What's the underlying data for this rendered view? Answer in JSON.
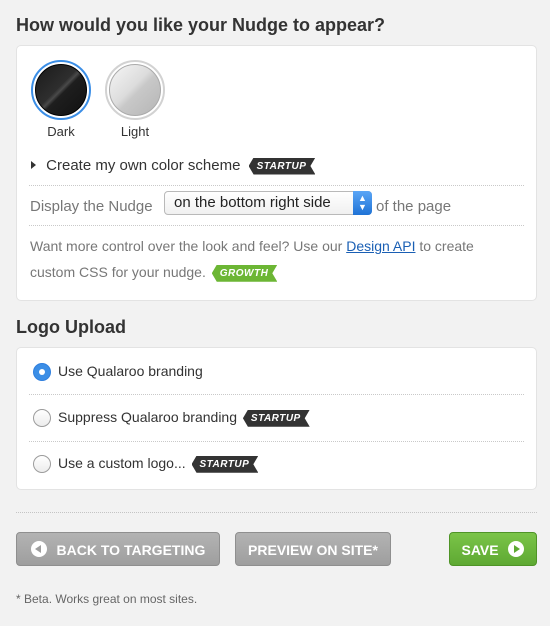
{
  "appearance": {
    "title": "How would you like your Nudge to appear?",
    "themes": [
      {
        "label": "Dark",
        "selected": true
      },
      {
        "label": "Light",
        "selected": false
      }
    ],
    "color_scheme_label": "Create my own color scheme",
    "color_scheme_badge": "STARTUP",
    "display_prefix": "Display the Nudge",
    "display_value": "on the bottom right side",
    "display_suffix": "of the page",
    "api_text_before": "Want more control over the look and feel? Use our",
    "api_link": "Design API",
    "api_text_after": "to create",
    "api_text_line2": "custom CSS for your nudge.",
    "api_badge": "GROWTH"
  },
  "logo": {
    "title": "Logo Upload",
    "options": [
      {
        "label": "Use Qualaroo branding",
        "checked": true,
        "badge": ""
      },
      {
        "label": "Suppress Qualaroo branding",
        "checked": false,
        "badge": "STARTUP"
      },
      {
        "label": "Use a custom logo...",
        "checked": false,
        "badge": "STARTUP"
      }
    ]
  },
  "actions": {
    "back_label": "BACK TO TARGETING",
    "preview_label": "PREVIEW ON SITE*",
    "save_label": "SAVE"
  },
  "footnote": "* Beta. Works great on most sites.",
  "colors": {
    "accent_blue": "#3b8ee6",
    "save_green": "#6cb634",
    "badge_dark": "#333333",
    "link_blue": "#1a5fb4"
  }
}
